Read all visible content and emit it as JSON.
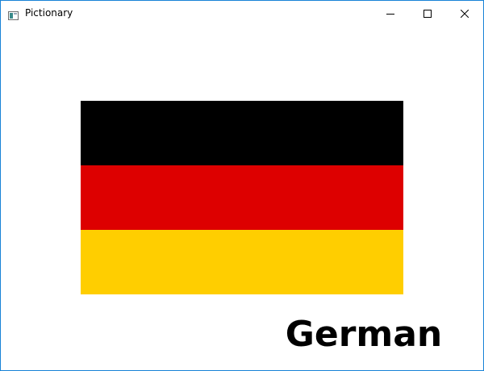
{
  "window": {
    "title": "Pictionary",
    "app_icon": "window-app-icon",
    "controls": {
      "minimize_icon": "minimize-icon",
      "maximize_icon": "maximize-icon",
      "close_icon": "close-icon"
    }
  },
  "picture": {
    "subject": "flag",
    "stripe_colors": [
      "#000000",
      "#dd0000",
      "#ffce00"
    ]
  },
  "caption": {
    "word": "German"
  },
  "colors": {
    "window_border": "#1883d7",
    "background": "#ffffff"
  }
}
